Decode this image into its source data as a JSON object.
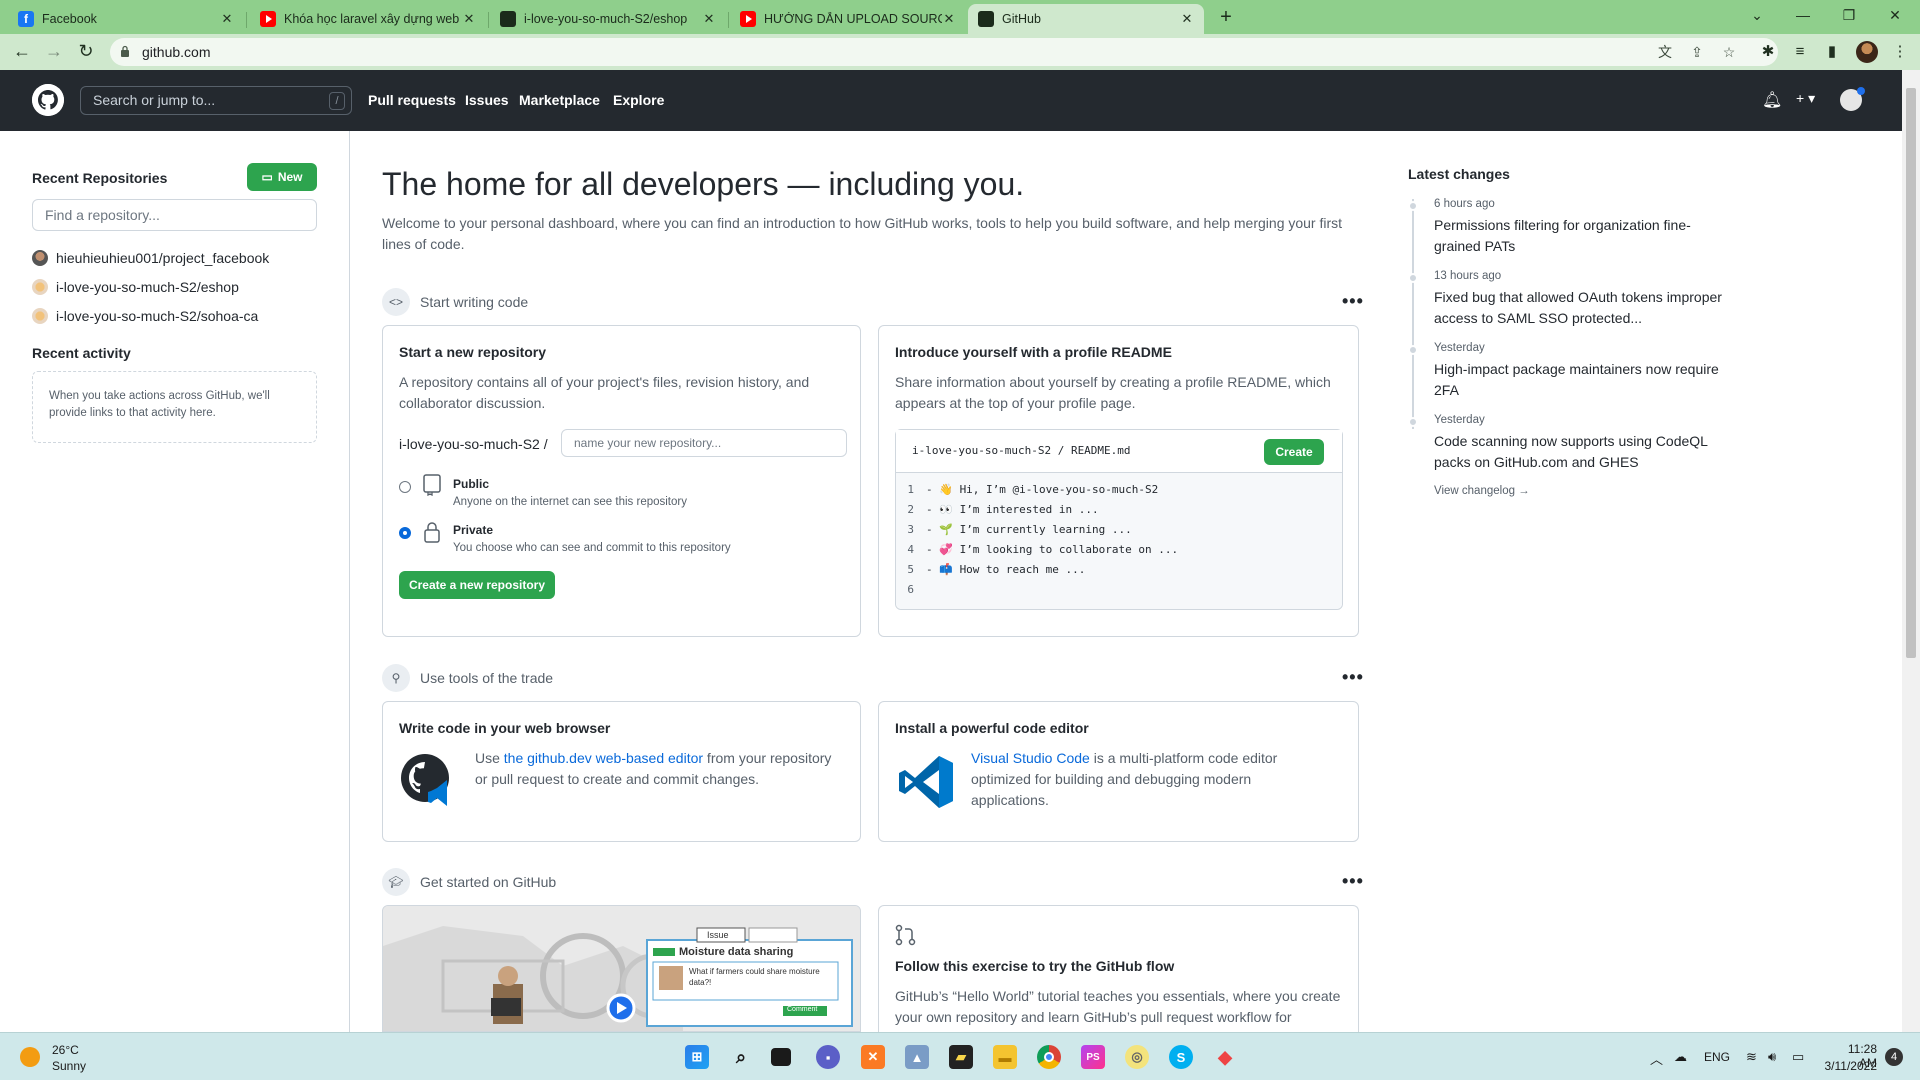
{
  "browser": {
    "tabs": [
      {
        "title": "Facebook",
        "icon": "facebook-icon"
      },
      {
        "title": "Khóa học laravel xây dựng web b",
        "icon": "youtube-icon"
      },
      {
        "title": "i-love-you-so-much-S2/eshop",
        "icon": "github-icon"
      },
      {
        "title": "HƯỚNG DẪN UPLOAD SOURCE C",
        "icon": "youtube-icon"
      },
      {
        "title": "GitHub",
        "icon": "github-icon",
        "active": true
      }
    ],
    "new_tab": "+",
    "url": "github.com"
  },
  "header": {
    "search_placeholder": "Search or jump to...",
    "search_shortcut": "/",
    "nav": [
      "Pull requests",
      "Issues",
      "Marketplace",
      "Explore"
    ],
    "plus": "+ ▾"
  },
  "sidebar": {
    "recent_repos_title": "Recent Repositories",
    "new_button": "New",
    "find_placeholder": "Find a repository...",
    "repos": [
      "hieuhieuhieu001/project_facebook",
      "i-love-you-so-much-S2/eshop",
      "i-love-you-so-much-S2/sohoa-ca"
    ],
    "recent_activity_title": "Recent activity",
    "activity_empty": "When you take actions across GitHub, we'll provide links to that activity here."
  },
  "main": {
    "hero_title": "The home for all developers — including you.",
    "hero_subtitle": "Welcome to your personal dashboard, where you can find an introduction to how GitHub works, tools to help you build software, and help merging your first lines of code.",
    "sections": {
      "start_writing": "Start writing code",
      "tools": "Use tools of the trade",
      "get_started": "Get started on GitHub"
    },
    "dots": "•••",
    "new_repo": {
      "title": "Start a new repository",
      "desc": "A repository contains all of your project's files, revision history, and collaborator discussion.",
      "owner": "i-love-you-so-much-S2 /",
      "name_placeholder": "name your new repository...",
      "public_label": "Public",
      "public_desc": "Anyone on the internet can see this repository",
      "private_label": "Private",
      "private_desc": "You choose who can see and commit to this repository",
      "create_button": "Create a new repository"
    },
    "readme": {
      "title": "Introduce yourself with a profile README",
      "desc": "Share information about yourself by creating a profile README, which appears at the top of your profile page.",
      "path": "i-love-you-so-much-S2 / README.md",
      "create_button": "Create",
      "lines": [
        {
          "n": "1",
          "text": "- 👋 Hi, I’m @i-love-you-so-much-S2"
        },
        {
          "n": "2",
          "text": "- 👀 I’m interested in ..."
        },
        {
          "n": "3",
          "text": "- 🌱 I’m currently learning ..."
        },
        {
          "n": "4",
          "text": "- 💞️ I’m looking to collaborate on ..."
        },
        {
          "n": "5",
          "text": "- 📫 How to reach me ..."
        },
        {
          "n": "6",
          "text": ""
        }
      ]
    },
    "web_editor": {
      "title": "Write code in your web browser",
      "pre": "Use ",
      "link": "the github.dev web-based editor",
      "post": " from your repository or pull request to create and commit changes."
    },
    "code_editor": {
      "title": "Install a powerful code editor",
      "link": "Visual Studio Code",
      "post": " is a multi-platform code editor optimized for building and debugging modern applications."
    },
    "video": {
      "bubble_title": "Moisture data sharing",
      "bubble_text": "What if farmers could share moisture data?!",
      "issue_tab": "Issue",
      "comment": "Comment"
    },
    "flow": {
      "title": "Follow this exercise to try the GitHub flow",
      "desc": "GitHub’s “Hello World” tutorial teaches you essentials, where you create your own repository and learn GitHub’s pull request workflow for"
    }
  },
  "changes": {
    "title": "Latest changes",
    "items": [
      {
        "time": "6 hours ago",
        "text": "Permissions filtering for organization fine-grained PATs"
      },
      {
        "time": "13 hours ago",
        "text": "Fixed bug that allowed OAuth tokens improper access to SAML SSO protected..."
      },
      {
        "time": "Yesterday",
        "text": "High-impact package maintainers now require 2FA"
      },
      {
        "time": "Yesterday",
        "text": "Code scanning now supports using CodeQL packs on GitHub.com and GHES"
      }
    ],
    "changelog_link": "View changelog →"
  },
  "taskbar": {
    "weather_temp": "26°C",
    "weather_desc": "Sunny",
    "lang": "ENG",
    "time": "11:28 AM",
    "date": "3/11/2022",
    "notifications": "4"
  }
}
